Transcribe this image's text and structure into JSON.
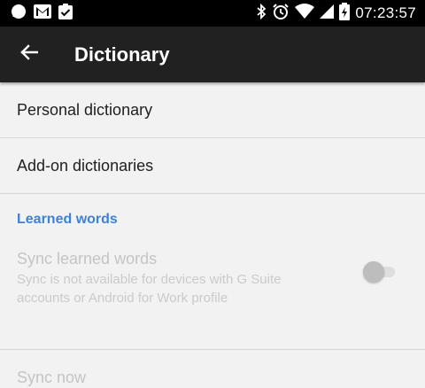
{
  "status_bar": {
    "time": "07:23:57",
    "left_icons": [
      "chat-bubble-icon",
      "gmail-icon",
      "clipboard-check-icon"
    ],
    "right_icons": [
      "bluetooth-icon",
      "alarm-icon",
      "wifi-icon",
      "cell-signal-icon",
      "battery-icon"
    ]
  },
  "app_bar": {
    "title": "Dictionary",
    "back_icon": "arrow-back-icon"
  },
  "items": {
    "personal_dictionary": "Personal dictionary",
    "addon_dictionaries": "Add-on dictionaries"
  },
  "learned_words": {
    "header": "Learned words",
    "sync_title": "Sync learned words",
    "sync_summary": "Sync is not available for devices with G Suite accounts or Android for Work profile",
    "sync_enabled": false,
    "sync_now": "Sync now"
  },
  "colors": {
    "accent": "#3b82db",
    "app_bar": "#212121",
    "background": "#f2f2f2"
  }
}
